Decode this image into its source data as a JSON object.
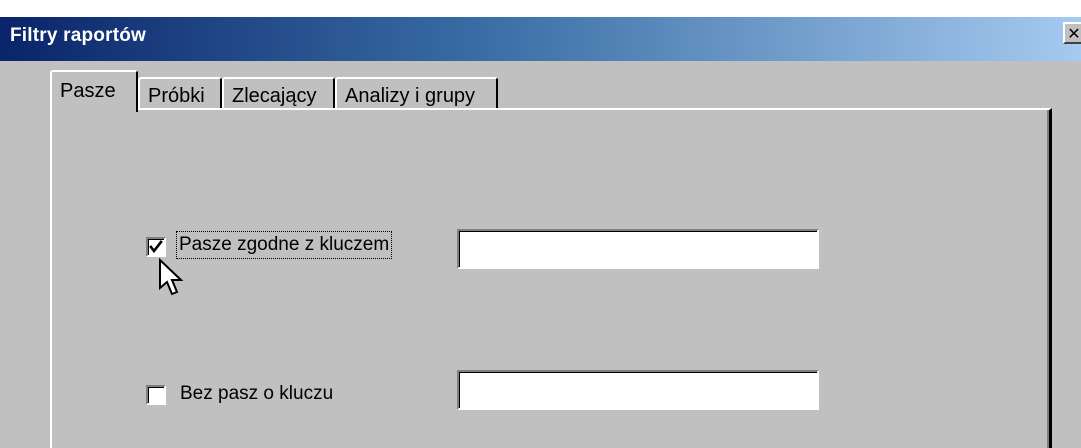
{
  "window": {
    "title": "Filtry raportów",
    "close_glyph": "✕"
  },
  "tabs": [
    {
      "label": "Pasze",
      "active": true
    },
    {
      "label": "Próbki",
      "active": false
    },
    {
      "label": "Zlecający",
      "active": false
    },
    {
      "label": "Analizy i grupy",
      "active": false
    }
  ],
  "filters": {
    "matching_key": {
      "label": "Pasze zgodne z kluczem",
      "checked": true,
      "value": ""
    },
    "without_key": {
      "label": "Bez pasz o kluczu",
      "checked": false,
      "value": ""
    }
  },
  "colors": {
    "titlebar_start": "#0a246a",
    "titlebar_end": "#a6caf0",
    "face": "#c0c0c0"
  },
  "icons": {
    "cursor": "arrow-pointer-icon",
    "check": "checkmark-icon"
  }
}
